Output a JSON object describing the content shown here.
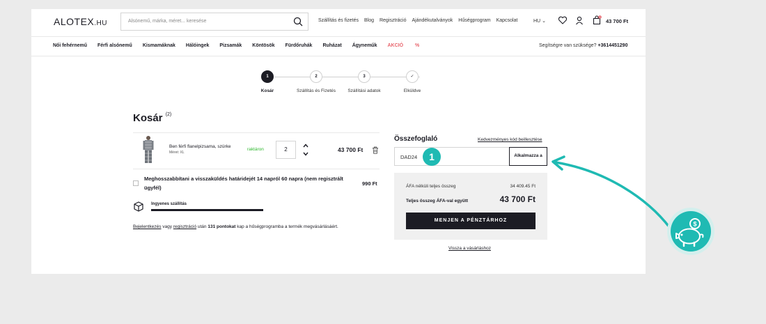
{
  "header": {
    "logo_main": "ALOTEX",
    "logo_suffix": ".HU",
    "search_placeholder": "Alsónemű, márka, méret... keresése",
    "top_links": [
      "Szállítás és fizetés",
      "Blog",
      "Regisztráció",
      "Ajándékutalványok",
      "Hűségprogram",
      "Kapcsolat"
    ],
    "language": "HU",
    "cart_count": "2",
    "cart_total": "43 700 Ft"
  },
  "categories": [
    "Női fehérnemű",
    "Férfi alsónemű",
    "Kismamáknak",
    "Hálóingek",
    "Pizsamák",
    "Köntösök",
    "Fürdőruhák",
    "Ruházat",
    "Ágyneműk"
  ],
  "sale_label": "AKCIÓ",
  "sale_symbol": "%",
  "help": {
    "question": "Segítségre van szüksége?",
    "phone": "+3614451290"
  },
  "steps": [
    {
      "number": "1",
      "label": "Kosár",
      "active": true
    },
    {
      "number": "2",
      "label": "Szállítás és Fizetés",
      "active": false
    },
    {
      "number": "3",
      "label": "Szállítási adatok",
      "active": false
    },
    {
      "number": "✓",
      "label": "Elküldve",
      "active": false
    }
  ],
  "cart": {
    "title": "Kosár",
    "count": "(2)",
    "item": {
      "name": "Ben férfi flanelpizsama, szürke",
      "size": "Méret: XL",
      "stock": "raktáron",
      "quantity": "2",
      "price": "43 700 Ft"
    },
    "extended_return": {
      "label": "Meghosszabbítani a visszaküldés határidejét 14 napról 60 napra (nem regisztrált ügyfél)",
      "price": "990 Ft"
    },
    "free_shipping": {
      "label": "Ingyenes szállítás",
      "progress": 1.0
    },
    "loyalty": {
      "login": "Bejelentkezés",
      "or": "vagy",
      "register": "regisztráció",
      "after": "után",
      "points": "131 pontokat",
      "rest": "kap a hűségprogramba a termék megvásárlásáért."
    }
  },
  "summary": {
    "title": "Összefoglaló",
    "promo_link": "Kedvezményes kód beillesztése",
    "promo_value": "DAD24",
    "apply_label": "Alkalmazza a",
    "badge_number": "1",
    "net_label": "ÁFA nélküli teljes összeg",
    "net_value": "34 409.45 Ft",
    "gross_label": "Teljes összeg ÁFA-val együtt",
    "gross_value": "43 700 Ft",
    "checkout_label": "MENJEN A PÉNZTÁRHOZ",
    "back_link": "Vissza a vásárláshoz"
  },
  "colors": {
    "dark": "#1c1c24",
    "accent_teal": "#1fbab3",
    "stock_green": "#2eb82e",
    "sale_red": "#e8656d"
  }
}
